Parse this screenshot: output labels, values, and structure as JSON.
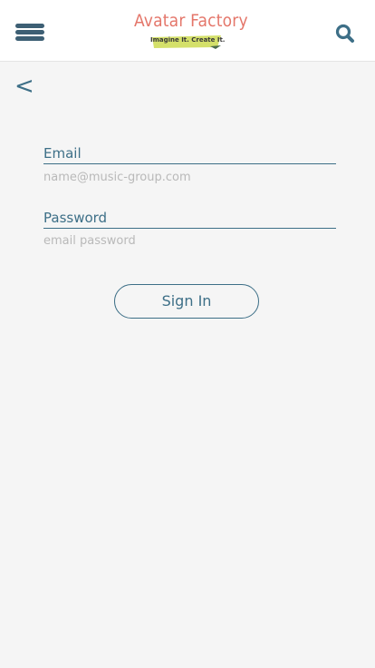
{
  "header": {
    "logo_title": "Avatar Factory",
    "logo_tagline": "Imagine It. Create It."
  },
  "nav": {
    "back_label": "<"
  },
  "form": {
    "email_label": "Email",
    "email_placeholder": "name@music-group.com",
    "email_value": "",
    "password_label": "Password",
    "password_placeholder": "email password",
    "password_value": "",
    "submit_label": "Sign In"
  },
  "colors": {
    "accent": "#3d6f87",
    "menu_icon": "#3d5f74",
    "logo_title": "#e4766a",
    "logo_ribbon": "#d4e06a",
    "background": "#f5f5f5",
    "header_bg": "#ffffff"
  },
  "icons": {
    "menu": "menu-icon",
    "search": "search-icon",
    "back": "back-arrow-icon"
  }
}
